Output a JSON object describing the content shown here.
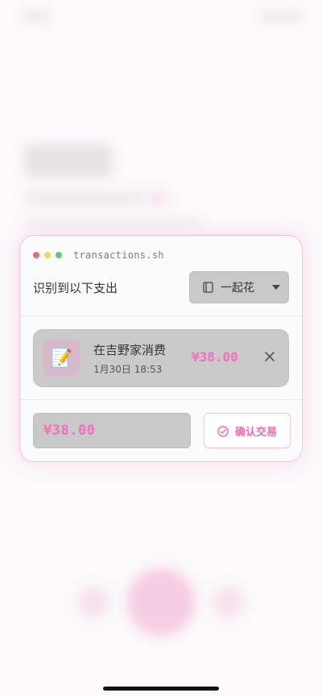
{
  "window": {
    "title": "transactions.sh"
  },
  "header": {
    "label": "识别到以下支出",
    "book_selector": {
      "icon": "book-icon",
      "value": "一起花"
    }
  },
  "transactions": [
    {
      "icon": "memo-pencil-icon",
      "icon_glyph": "📝",
      "name": "在吉野家消费",
      "time": "1月30日 18:53",
      "amount": "¥38.00"
    }
  ],
  "footer": {
    "total": "¥38.00",
    "confirm_label": "确认交易",
    "confirm_icon": "check-circle-icon"
  },
  "colors": {
    "accent": "#f36fbd",
    "accent_border": "#f6c3dd"
  }
}
